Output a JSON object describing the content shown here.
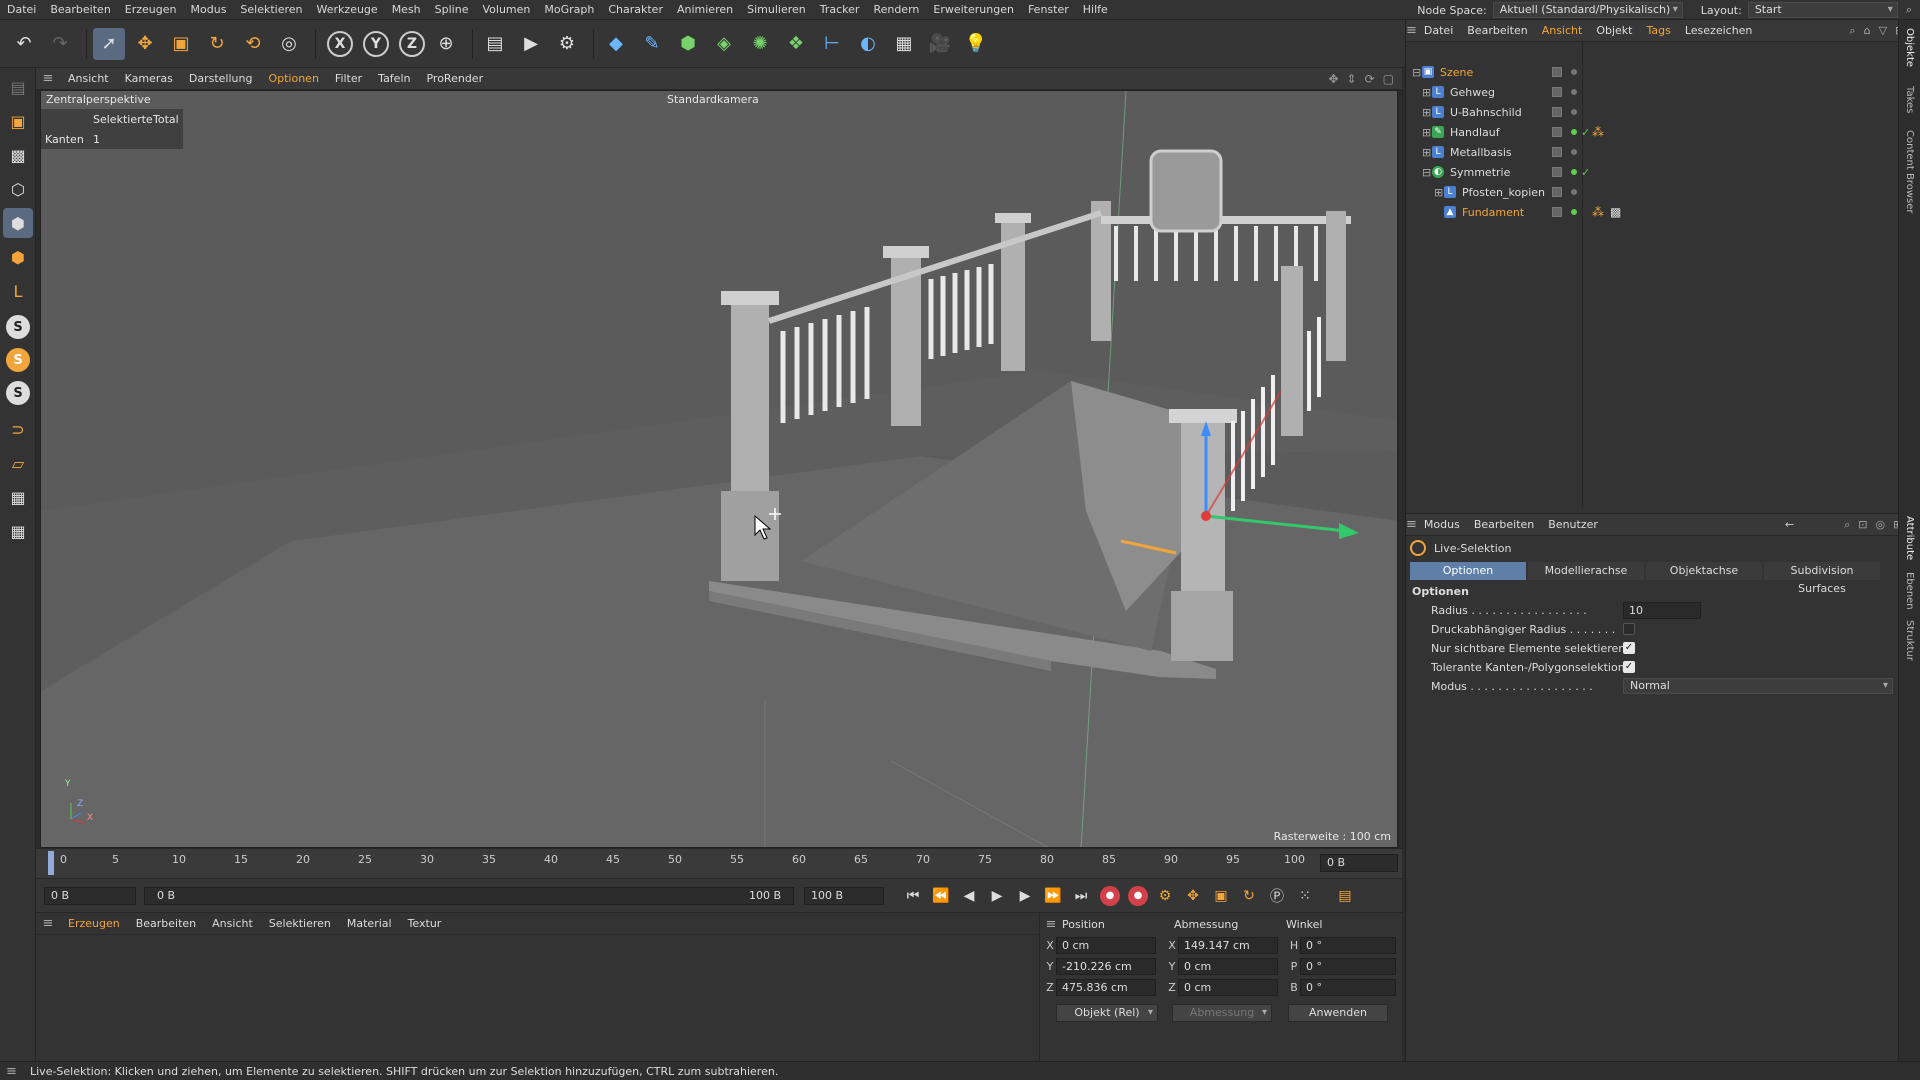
{
  "menubar": {
    "items": [
      "Datei",
      "Bearbeiten",
      "Erzeugen",
      "Modus",
      "Selektieren",
      "Werkzeuge",
      "Mesh",
      "Spline",
      "Volumen",
      "MoGraph",
      "Charakter",
      "Animieren",
      "Simulieren",
      "Tracker",
      "Rendern",
      "Erweiterungen",
      "Fenster",
      "Hilfe"
    ],
    "node_space_label": "Node Space:",
    "node_space_value": "Aktuell (Standard/Physikalisch)",
    "layout_label": "Layout:",
    "layout_value": "Start"
  },
  "toolbar": {
    "axis_labels": [
      "X",
      "Y",
      "Z"
    ]
  },
  "viewport": {
    "menu": [
      "Ansicht",
      "Kameras",
      "Darstellung",
      "Optionen",
      "Filter",
      "Tafeln",
      "ProRender"
    ],
    "active_menu": "Optionen",
    "view_name": "Zentralperspektive",
    "camera": "Standardkamera",
    "hud_col1": "Selektierte",
    "hud_col2": "Total",
    "hud_row_label": "Kanten",
    "hud_row_value": "1",
    "grid_info": "Rasterweite : 100 cm",
    "axis_y": "Y",
    "axis_z": "Z",
    "axis_x": "X"
  },
  "timeline": {
    "ticks": [
      "0",
      "5",
      "10",
      "15",
      "20",
      "25",
      "30",
      "35",
      "40",
      "45",
      "50",
      "55",
      "60",
      "65",
      "70",
      "75",
      "80",
      "85",
      "90",
      "95",
      "100"
    ],
    "current_frame": "0 B"
  },
  "transport": {
    "start": "0 B",
    "range_start": "0 B",
    "range_end": "100 B",
    "end": "100 B"
  },
  "material_panel": {
    "menu": [
      "Erzeugen",
      "Bearbeiten",
      "Ansicht",
      "Selektieren",
      "Material",
      "Textur"
    ]
  },
  "coords": {
    "headers": [
      "Position",
      "Abmessung",
      "Winkel"
    ],
    "rows": [
      {
        "pos_label": "X",
        "pos": "0 cm",
        "size_label": "X",
        "size": "149.147 cm",
        "rot_label": "H",
        "rot": "0 °"
      },
      {
        "pos_label": "Y",
        "pos": "-210.226 cm",
        "size_label": "Y",
        "size": "0 cm",
        "rot_label": "P",
        "rot": "0 °"
      },
      {
        "pos_label": "Z",
        "pos": "475.836 cm",
        "size_label": "Z",
        "size": "0 cm",
        "rot_label": "B",
        "rot": "0 °"
      }
    ],
    "mode": "Objekt (Rel)",
    "size_mode": "Abmessung",
    "apply": "Anwenden"
  },
  "objects": {
    "menu": [
      "Datei",
      "Bearbeiten",
      "Ansicht",
      "Objekt",
      "Tags",
      "Lesezeichen"
    ],
    "active_menu": "Ansicht",
    "items": [
      {
        "name": "Szene",
        "selected": true
      },
      {
        "name": "Gehweg",
        "selected": false
      },
      {
        "name": "U-Bahnschild",
        "selected": false
      },
      {
        "name": "Handlauf",
        "selected": false
      },
      {
        "name": "Metallbasis",
        "selected": false
      },
      {
        "name": "Symmetrie",
        "selected": false
      },
      {
        "name": "Pfosten_kopien",
        "selected": false
      },
      {
        "name": "Fundament",
        "selected": true
      }
    ]
  },
  "attributes": {
    "menu": [
      "Modus",
      "Bearbeiten",
      "Benutzer"
    ],
    "tool_name": "Live-Selektion",
    "tabs": [
      "Optionen",
      "Modellierachse",
      "Objektachse",
      "Subdivision Surfaces"
    ],
    "active_tab": "Optionen",
    "section": "Optionen",
    "radius_label": "Radius . . . . . . . . . . . . . . . . .",
    "radius_value": "10",
    "pressure_label": "Druckabhängiger Radius . . . . . . .",
    "pressure_checked": false,
    "visible_only_label": "Nur sichtbare Elemente selektieren",
    "visible_only_checked": true,
    "tolerant_label": "Tolerante Kanten-/Polygonselektion",
    "tolerant_checked": true,
    "mode_label": "Modus . . . . . . . . . . . . . . . . . .",
    "mode_value": "Normal"
  },
  "siderail": {
    "tabs": [
      "Objekte",
      "Takes",
      "Content Browser",
      "Attribute",
      "Ebenen",
      "Struktur"
    ]
  },
  "statusbar": {
    "text": "Live-Selektion: Klicken und ziehen, um Elemente zu selektieren. SHIFT drücken um zur Selektion hinzuzufügen, CTRL zum subtrahieren."
  },
  "colors": {
    "accent": "#f2a53a",
    "selection_blue": "#5f7fa8",
    "viewport_bg": "#5b5b5b"
  }
}
